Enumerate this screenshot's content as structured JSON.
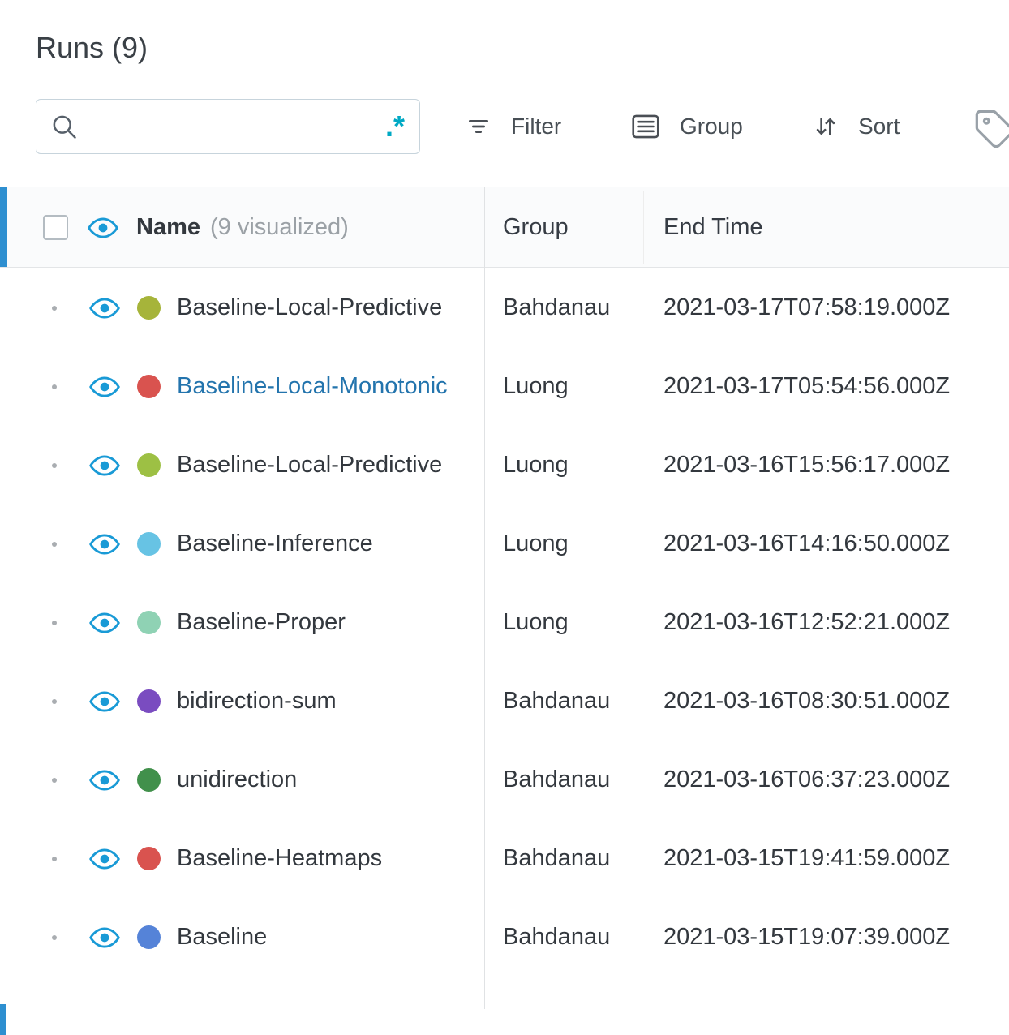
{
  "header": {
    "title": "Runs (9)",
    "search": {
      "value": "",
      "placeholder": "",
      "regex_label": ".*"
    },
    "toolbar": {
      "filter": "Filter",
      "group": "Group",
      "sort": "Sort"
    }
  },
  "table": {
    "header": {
      "name": "Name",
      "name_note": "(9 visualized)",
      "group": "Group",
      "end_time": "End Time"
    },
    "rows": [
      {
        "name": "Baseline-Local-Predictive",
        "color": "#a6b43a",
        "group": "Bahdanau",
        "end_time": "2021-03-17T07:58:19.000Z",
        "link": false
      },
      {
        "name": "Baseline-Local-Monotonic",
        "color": "#d9534f",
        "group": "Luong",
        "end_time": "2021-03-17T05:54:56.000Z",
        "link": true
      },
      {
        "name": "Baseline-Local-Predictive",
        "color": "#9dc044",
        "group": "Luong",
        "end_time": "2021-03-16T15:56:17.000Z",
        "link": false
      },
      {
        "name": "Baseline-Inference",
        "color": "#67c3e4",
        "group": "Luong",
        "end_time": "2021-03-16T14:16:50.000Z",
        "link": false
      },
      {
        "name": "Baseline-Proper",
        "color": "#8fd2b4",
        "group": "Luong",
        "end_time": "2021-03-16T12:52:21.000Z",
        "link": false
      },
      {
        "name": "bidirection-sum",
        "color": "#7a4cc0",
        "group": "Bahdanau",
        "end_time": "2021-03-16T08:30:51.000Z",
        "link": false
      },
      {
        "name": "unidirection",
        "color": "#41904b",
        "group": "Bahdanau",
        "end_time": "2021-03-16T06:37:23.000Z",
        "link": false
      },
      {
        "name": "Baseline-Heatmaps",
        "color": "#d9534f",
        "group": "Bahdanau",
        "end_time": "2021-03-15T19:41:59.000Z",
        "link": false
      },
      {
        "name": "Baseline",
        "color": "#5583d8",
        "group": "Bahdanau",
        "end_time": "2021-03-15T19:07:39.000Z",
        "link": false
      }
    ]
  },
  "colors": {
    "accent_blue": "#2e8fd0",
    "eye_blue": "#199ad6",
    "link_blue": "#2374ad",
    "regex_teal": "#00a9c4"
  },
  "icons": {
    "search": "magnifier",
    "regex": "dot-asterisk",
    "filter": "three-lines-funnel",
    "group": "list-box",
    "sort": "down-up-arrows",
    "tag": "label-tag",
    "eye": "visibility-eye",
    "drag": "handle-dot"
  }
}
